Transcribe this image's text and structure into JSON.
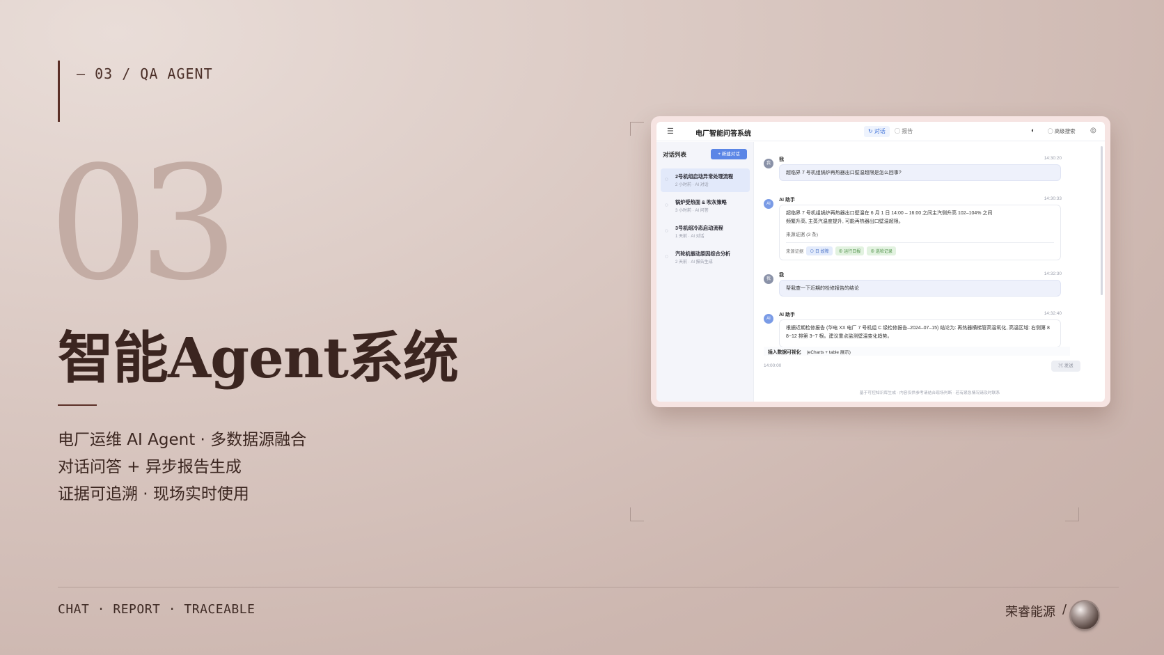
{
  "slide": {
    "section_label": "— 03 / QA AGENT",
    "big_number": "03",
    "headline": "智能Agent系统",
    "subtitles": [
      "电厂运维 AI Agent · 多数据源融合",
      "对话问答 + 异步报告生成",
      "证据可追溯 · 现场实时使用"
    ],
    "footer_tags": "CHAT · REPORT · TRACEABLE",
    "brand": "荣睿能源",
    "brand_slash": "/"
  },
  "app": {
    "title": "电厂智能问答系统",
    "tabs": [
      {
        "label": "↻ 对话",
        "active": true
      },
      {
        "label": "◯ 报告",
        "active": false
      }
    ],
    "toolbar": {
      "icon": "◐",
      "button_label": "◯ 高级搜索",
      "user_icon": "◎"
    },
    "sidebar": {
      "title": "对话列表",
      "new_button": "+ 新建对话",
      "conversations": [
        {
          "title": "2号机组启动异常处理流程",
          "meta": "2 小时前 · AI 对话",
          "active": true
        },
        {
          "title": "锅炉受热面 & 吹灰策略",
          "meta": "3 小时前 · AI 问答",
          "active": false
        },
        {
          "title": "3号机组冷态启动流程",
          "meta": "1 天前 · AI 对话",
          "active": false
        },
        {
          "title": "汽轮机振动原因综合分析",
          "meta": "2 天前 · AI 报告生成",
          "active": false
        }
      ]
    },
    "messages": [
      {
        "sender": "我",
        "avatar": "我",
        "time": "14:30:20",
        "text": "超临界 7 号机组锅炉再热器出口壁温超限是怎么回事?"
      },
      {
        "sender": "AI 助手",
        "avatar": "AI",
        "time": "14:30:33",
        "lines": [
          "超临界 7 号机组锅炉再热器出口壁温在 6 月 1 日 14:00 – 16:00 之间主汽侧升高 102–104% 之间",
          "频繁升高, 主蒸汽温度提升, 可能再热器出口壁温超限。"
        ],
        "source": "来源证据 (3 条)",
        "evidence_label": "来源证据",
        "evidence_tags": [
          {
            "label": "⊙ 日 故障",
            "color": "blue"
          },
          {
            "label": "⊕ 运行日报",
            "color": "green"
          },
          {
            "label": "⊕ 巡检记录",
            "color": "green"
          }
        ]
      },
      {
        "sender": "我",
        "avatar": "我",
        "time": "14:32:30",
        "text": "帮我查一下近期的检修报告的结论"
      },
      {
        "sender": "AI 助手",
        "avatar": "AI",
        "time": "14:32:40",
        "lines": [
          "根据近期检修报告 (华电 XX 电厂 7 号机组 C 级检修报告–2024–07–15) 结论为: 再热器横梯管高温氧化, 高温区域: 右侧第 8",
          "8~12 排第 3~7 根。建议重点监测壁温变化趋势。"
        ]
      }
    ],
    "insert_bar": {
      "label": "插入数据可视化",
      "hint": "(eCharts + table 展示)"
    },
    "input_time": "14:00:00",
    "send_button": "⌘ 发送",
    "disclaimer": "基于可控知识库生成 · 内容仅供参考请结合现场判断 · 若有紧急情况请及时联系"
  }
}
